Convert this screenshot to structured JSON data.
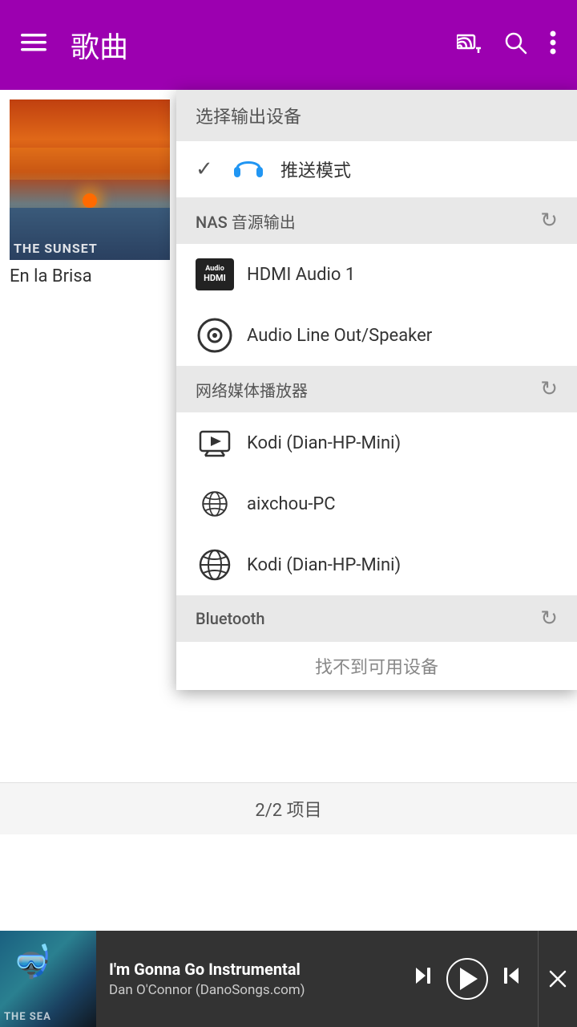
{
  "header": {
    "title": "歌曲",
    "menu_label": "≡",
    "cast_label": "cast",
    "search_label": "search",
    "more_label": "⋮"
  },
  "dropdown": {
    "title": "选择输出设备",
    "push_mode": {
      "label": "推送模式",
      "selected": true
    },
    "nas_section": {
      "label": "NAS 音源输出",
      "devices": [
        {
          "name": "HDMI Audio 1",
          "type": "hdmi"
        },
        {
          "name": "Audio Line Out/Speaker",
          "type": "speaker"
        }
      ]
    },
    "media_section": {
      "label": "网络媒体播放器",
      "devices": [
        {
          "name": "Kodi (Dian-HP-Mini)",
          "type": "stream"
        },
        {
          "name": "aixchou-PC",
          "type": "stream2"
        },
        {
          "name": "Kodi (Dian-HP-Mini)",
          "type": "stream"
        }
      ]
    },
    "bluetooth_section": {
      "label": "Bluetooth",
      "no_device_label": "找不到可用设备"
    }
  },
  "song": {
    "name": "En la Brisa",
    "thumbnail_label": "THE SUNSET"
  },
  "status_bar": {
    "label": "2/2 项目"
  },
  "now_playing": {
    "title": "I'm Gonna Go Instrumental",
    "artist": "Dan O'Connor (DanoSongs.com)",
    "thumbnail_label": "THE SEA"
  }
}
